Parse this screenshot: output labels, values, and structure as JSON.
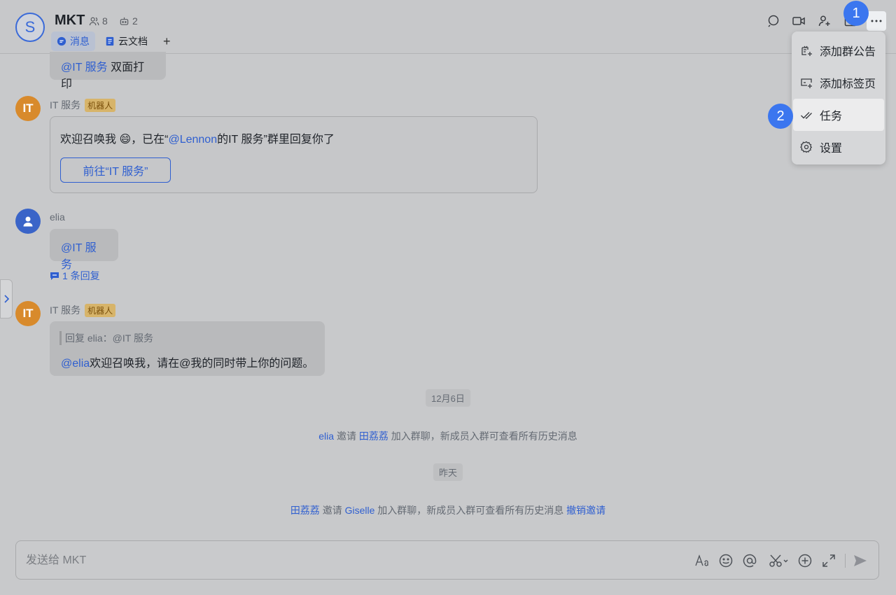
{
  "header": {
    "avatar_letter": "S",
    "title": "MKT",
    "member_count": "8",
    "bot_count": "2",
    "tabs": [
      {
        "label": "消息",
        "active": true
      },
      {
        "label": "云文档",
        "active": false
      }
    ],
    "add_tab": "+"
  },
  "menu": {
    "items": [
      {
        "label": "添加群公告",
        "icon": "announcement-add-icon"
      },
      {
        "label": "添加标签页",
        "icon": "tab-add-icon"
      },
      {
        "label": "任务",
        "icon": "task-check-icon"
      },
      {
        "label": "设置",
        "icon": "gear-icon"
      }
    ]
  },
  "badges": {
    "one": "1",
    "two": "2"
  },
  "messages": {
    "top_bubble": {
      "mention": "@IT 服务",
      "text": "双面打印"
    },
    "bot1": {
      "avatar": "IT",
      "sender": "IT 服务",
      "tag": "机器人",
      "text_pre": "欢迎召唤我 😄，已在“",
      "mention": "@Lennon",
      "text_post": "的IT 服务”群里回复你了",
      "button": "前往“IT 服务”"
    },
    "elia": {
      "sender": "elia",
      "mention": "@IT 服务",
      "reply_count": "1 条回复"
    },
    "bot2": {
      "avatar": "IT",
      "sender": "IT 服务",
      "tag": "机器人",
      "quote": "回复 elia：@IT 服务",
      "mention": "@elia",
      "text": "欢迎召唤我，请在@我的同时带上你的问题。"
    }
  },
  "system": {
    "date1": "12月6日",
    "event1": {
      "user1": "elia",
      "verb": "邀请",
      "user2": "田荔荔",
      "rest": "加入群聊，新成员入群可查看所有历史消息"
    },
    "date2": "昨天",
    "event2": {
      "user1": "田荔荔",
      "verb": "邀请",
      "user2": "Giselle",
      "rest": "加入群聊，新成员入群可查看所有历史消息",
      "action": "撤销邀请"
    }
  },
  "composer": {
    "placeholder": "发送给 MKT"
  }
}
